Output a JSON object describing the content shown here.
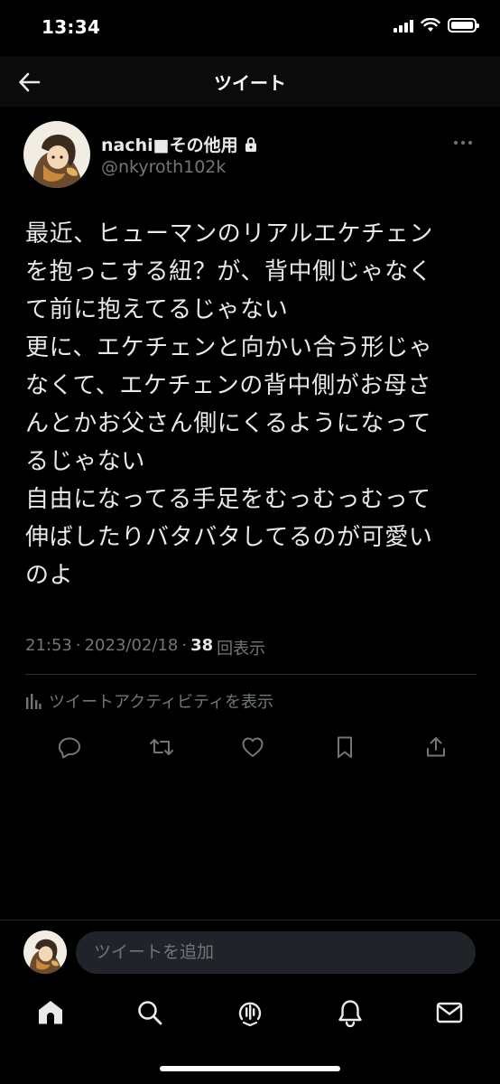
{
  "status_bar": {
    "time": "13:34",
    "battery_level": 1.0
  },
  "header": {
    "title": "ツイート"
  },
  "tweet": {
    "author": {
      "display_name": "nachi■その他用",
      "handle": "@nkyroth102k",
      "protected": true
    },
    "text": "最近、ヒューマンのリアルエケチェン\nを抱っこする紐？が、背中側じゃなく\nて前に抱えてるじゃない\n更に、エケチェンと向かい合う形じゃ\nなくて、エケチェンの背中側がお母さ\nんとかお父さん側にくるようになって\nるじゃない\n自由になってる手足をむっむっむって\n伸ばしたりバタバタしてるのが可愛い\nのよ",
    "time": "21:53",
    "date": "2023/02/18",
    "separator": "·",
    "views_count": "38",
    "views_label": "回表示",
    "activity_label": "ツイートアクティビティを表示"
  },
  "composer": {
    "placeholder": "ツイートを追加"
  },
  "tabs": [
    "home",
    "search",
    "spaces",
    "notifications",
    "messages"
  ],
  "icons": {
    "back": "arrow-left-icon",
    "more": "more-horizontal-icon",
    "lock": "lock-icon",
    "reply": "reply-icon",
    "retweet": "retweet-icon",
    "like": "heart-icon",
    "bookmark": "bookmark-icon",
    "share": "share-icon",
    "activity": "bar-chart-icon"
  },
  "colors": {
    "background": "#000000",
    "text_primary": "#e7e9ea",
    "text_secondary": "#71767b",
    "divider": "#2f3336"
  }
}
